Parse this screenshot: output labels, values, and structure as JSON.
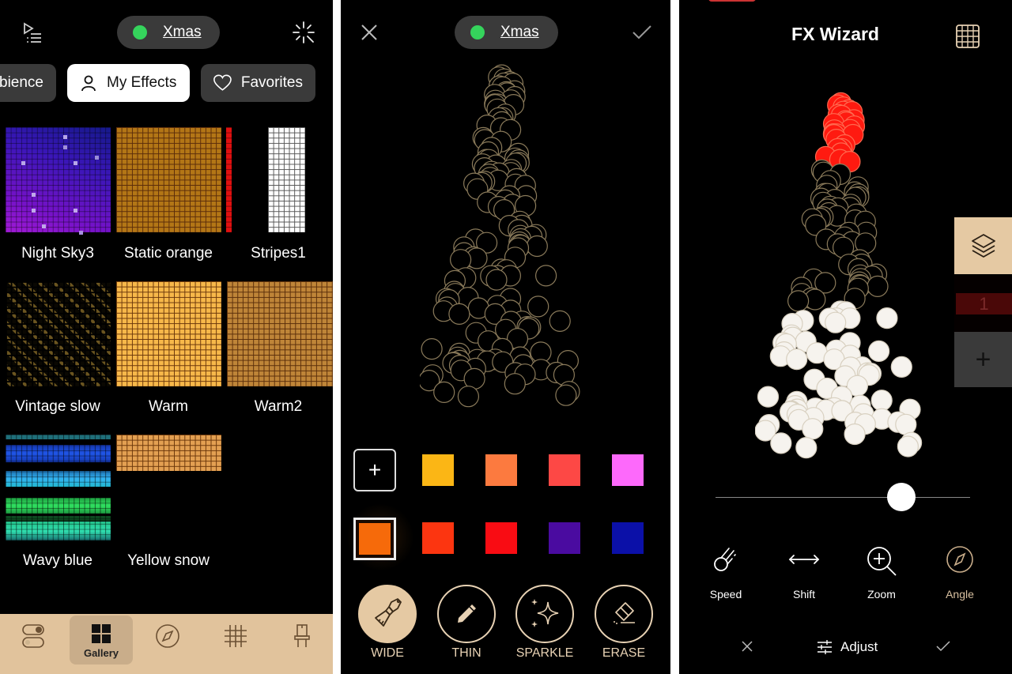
{
  "panel1": {
    "header": {
      "playlist_icon": "playlist-icon",
      "device_name": "Xmas",
      "status_color": "#35d45c",
      "sparkle_icon": "effects-icon"
    },
    "tabs": [
      {
        "label": "bience",
        "icon": "none",
        "active": false
      },
      {
        "label": "My Effects",
        "icon": "person-icon",
        "active": true
      },
      {
        "label": "Favorites",
        "icon": "heart-icon",
        "active": false
      }
    ],
    "effects": [
      {
        "name": "Night Sky3"
      },
      {
        "name": "Static orange"
      },
      {
        "name": "Stripes1"
      },
      {
        "name": "Vintage slow"
      },
      {
        "name": "Warm"
      },
      {
        "name": "Warm2"
      },
      {
        "name": "Wavy blue"
      },
      {
        "name": "Yellow snow"
      }
    ],
    "nav": [
      {
        "icon": "toggles-icon",
        "label": ""
      },
      {
        "icon": "gallery-grid-icon",
        "label": "Gallery",
        "active": true
      },
      {
        "icon": "compass-icon",
        "label": ""
      },
      {
        "icon": "hashtag-grid-icon",
        "label": ""
      },
      {
        "icon": "lamp-icon",
        "label": ""
      }
    ]
  },
  "panel2": {
    "header": {
      "close_icon": "close-icon",
      "device_name": "Xmas",
      "status_color": "#35d45c",
      "confirm_icon": "check-icon"
    },
    "palette": {
      "add_label": "+",
      "row1": [
        "#fbb615",
        "#fc7a3f",
        "#fd4845",
        "#fd69fb"
      ],
      "selected": "#f66a0a",
      "row2": [
        "#fc3510",
        "#f90c13",
        "#4a0ba0",
        "#0b10a8"
      ]
    },
    "tools": [
      {
        "label": "WIDE",
        "icon": "paintbrush-icon",
        "active": true
      },
      {
        "label": "THIN",
        "icon": "pencil-icon",
        "active": false
      },
      {
        "label": "SPARKLE",
        "icon": "sparkle-icon",
        "active": false
      },
      {
        "label": "ERASE",
        "icon": "eraser-icon",
        "active": false
      }
    ]
  },
  "panel3": {
    "title": "FX Wizard",
    "grid_icon": "grid-icon",
    "layers": {
      "layer_number": "1",
      "add_label": "+"
    },
    "slider_value": 0.73,
    "controls": [
      {
        "label": "Speed",
        "icon": "speed-icon"
      },
      {
        "label": "Shift",
        "icon": "shift-arrows-icon"
      },
      {
        "label": "Zoom",
        "icon": "zoom-in-icon"
      },
      {
        "label": "Angle",
        "icon": "compass-icon"
      }
    ],
    "footer": {
      "cancel_icon": "close-icon",
      "adjust_label": "Adjust",
      "confirm_icon": "check-icon"
    }
  },
  "colors": {
    "accent": "#e1c39c",
    "pill_bg": "#3a3a3a",
    "hat_red": "#ff1a10",
    "snow_white": "#f6f3ee"
  }
}
